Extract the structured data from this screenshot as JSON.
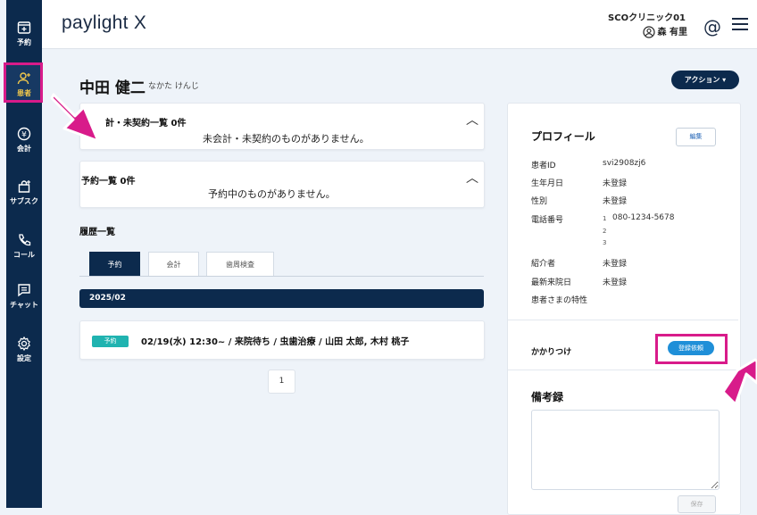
{
  "sidebar": {
    "items": [
      {
        "label": "予約",
        "icon": "calendar-plus-icon"
      },
      {
        "label": "患者",
        "icon": "add-person-icon"
      },
      {
        "label": "会計",
        "icon": "yen-icon"
      },
      {
        "label": "サブスク",
        "icon": "bag-plus-icon"
      },
      {
        "label": "コール",
        "icon": "phone-icon"
      },
      {
        "label": "チャット",
        "icon": "chat-icon"
      },
      {
        "label": "設定",
        "icon": "gear-icon"
      }
    ]
  },
  "header": {
    "logo": "paylight X",
    "clinic": "SCOクリニック01",
    "user": "森 有里"
  },
  "patient": {
    "name": "中田 健二",
    "kana": "なかた けんじ",
    "action_label": "アクション ▾"
  },
  "unpaid": {
    "title": "未会計・未契約一覧 0件",
    "title_visible": "計・未契約一覧 0件",
    "message": "未会計・未契約のものがありません。"
  },
  "reservations": {
    "title": "予約一覧 0件",
    "message": "予約中のものがありません。"
  },
  "history": {
    "title": "履歴一覧",
    "tabs": [
      "予約",
      "会計",
      "歯周検査"
    ],
    "month": "2025/02",
    "entry": {
      "badge": "予約",
      "text": "02/19(水) 12:30~ / 来院待ち / 虫歯治療 / 山田 太郎, 木村 桃子"
    },
    "page": "1"
  },
  "profile": {
    "title": "プロフィール",
    "edit_label": "編集",
    "rows": [
      {
        "label": "患者ID",
        "value": "svi2908zj6"
      },
      {
        "label": "生年月日",
        "value": "未登録"
      },
      {
        "label": "性別",
        "value": "未登録"
      },
      {
        "label": "電話番号",
        "value": "080-1234-5678"
      },
      {
        "label": "紹介者",
        "value": "未登録"
      },
      {
        "label": "最新来院日",
        "value": "未登録"
      },
      {
        "label": "患者さまの特性",
        "value": ""
      }
    ],
    "phone_index": [
      "1",
      "2",
      "3"
    ],
    "kakari_label": "かかりつけ",
    "register_label": "登録依頼",
    "notes_title": "備考録",
    "save_label": "保存"
  },
  "colors": {
    "navy": "#0c2a4d",
    "highlight": "#d81b8a",
    "teal": "#20b3b0",
    "blue": "#1f8fd8"
  }
}
